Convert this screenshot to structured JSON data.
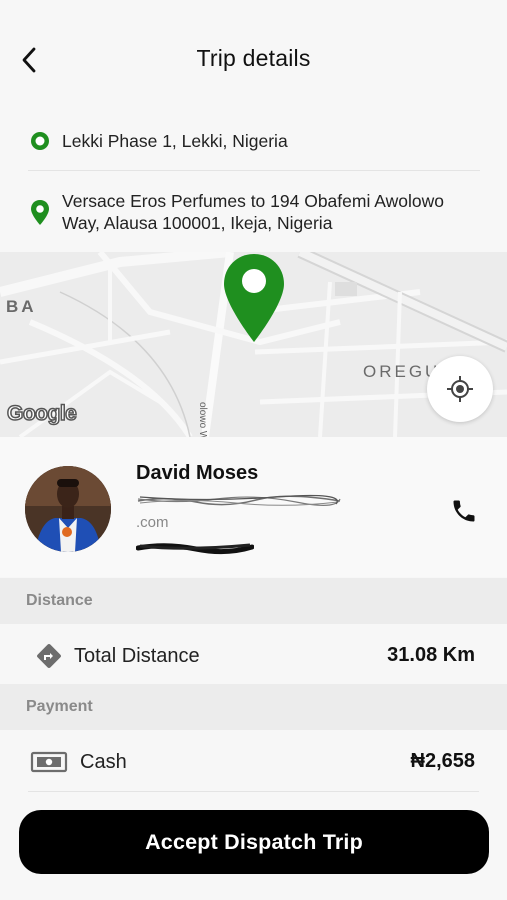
{
  "header": {
    "title": "Trip details"
  },
  "route": {
    "pickup": "Lekki Phase 1, Lekki, Nigeria",
    "dropoff": "Versace Eros Perfumes to 194 Obafemi Awolowo Way, Alausa 100001, Ikeja, Nigeria",
    "pickup_icon": "pickup-dot-icon",
    "dropoff_icon": "map-pin-icon"
  },
  "map": {
    "label_left": "BA",
    "label_right": "OREGU",
    "road_label": "olowo Way",
    "attribution": "Google",
    "locate_icon": "my-location-icon"
  },
  "driver": {
    "name": "David Moses",
    "email_domain": ".com",
    "call_icon": "phone-icon"
  },
  "sections": {
    "distance_header": "Distance",
    "payment_header": "Payment"
  },
  "distance": {
    "label": "Total Distance",
    "value": "31.08 Km",
    "icon": "directions-icon"
  },
  "payment": {
    "label": "Cash",
    "value": "₦2,658",
    "icon": "cash-icon"
  },
  "actions": {
    "accept_label": "Accept Dispatch Trip"
  },
  "colors": {
    "accent_green": "#1f8f1f",
    "primary_button": "#000000"
  }
}
